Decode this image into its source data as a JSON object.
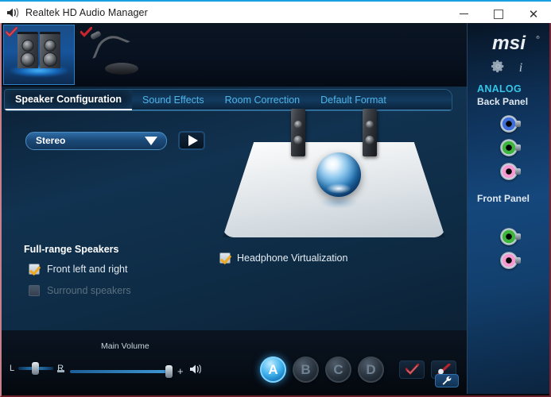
{
  "window": {
    "title": "Realtek HD Audio Manager",
    "icon": "sound-icon",
    "controls": {
      "minimize": "minimize-icon",
      "maximize": "maximize-icon",
      "close": "close-icon"
    }
  },
  "devices": [
    {
      "name": "speakers-device",
      "icon": "speakers-icon",
      "selected": true,
      "checked": true
    },
    {
      "name": "microphone-device",
      "icon": "microphone-icon",
      "selected": false,
      "checked": true
    }
  ],
  "tabs": [
    {
      "label": "Speaker Configuration",
      "active": true
    },
    {
      "label": "Sound Effects",
      "active": false
    },
    {
      "label": "Room Correction",
      "active": false
    },
    {
      "label": "Default Format",
      "active": false
    }
  ],
  "config": {
    "speaker_mode": "Stereo",
    "play_icon": "play-icon"
  },
  "options": {
    "headphone_virtualization": {
      "label": "Headphone Virtualization",
      "checked": true
    },
    "full_range_title": "Full-range Speakers",
    "front_left_right": {
      "label": "Front left and right",
      "checked": true
    },
    "surround_speakers": {
      "label": "Surround speakers",
      "checked": false,
      "disabled": true
    }
  },
  "volume": {
    "main_label": "Main Volume",
    "left_label": "L",
    "right_label": "R",
    "balance_percent": 50,
    "level_percent": 100,
    "minus": "—",
    "plus": "+",
    "speaker_icon": "volume-speaker-icon"
  },
  "profiles": [
    {
      "label": "A",
      "active": true
    },
    {
      "label": "B",
      "active": false
    },
    {
      "label": "C",
      "active": false
    },
    {
      "label": "D",
      "active": false
    }
  ],
  "actions": [
    {
      "name": "confirm-button",
      "icon": "check-icon"
    },
    {
      "name": "edit-button",
      "icon": "pen-icon"
    }
  ],
  "sidebar": {
    "brand": "msi",
    "gear_icon": "gear-icon",
    "info_icon": "info-icon",
    "analog_label": "ANALOG",
    "back_panel_label": "Back Panel",
    "front_panel_label": "Front Panel",
    "back_jacks": [
      {
        "name": "jack-blue-line-in",
        "color": "#3f6fd8"
      },
      {
        "name": "jack-green-line-out",
        "color": "#3fb53f"
      },
      {
        "name": "jack-pink-mic-in",
        "color": "#f49ad0"
      }
    ],
    "front_jacks": [
      {
        "name": "jack-green-headphone",
        "color": "#3fb53f"
      },
      {
        "name": "jack-pink-mic",
        "color": "#f49ad0"
      }
    ]
  },
  "footer": {
    "wrench_icon": "wrench-icon"
  },
  "colors": {
    "accent_cyan": "#34c6e8",
    "tab_blue": "#4fb4e8",
    "check_orange": "#f0a81e",
    "frame_red": "#7a2330",
    "title_accent": "#1a9fe0"
  }
}
